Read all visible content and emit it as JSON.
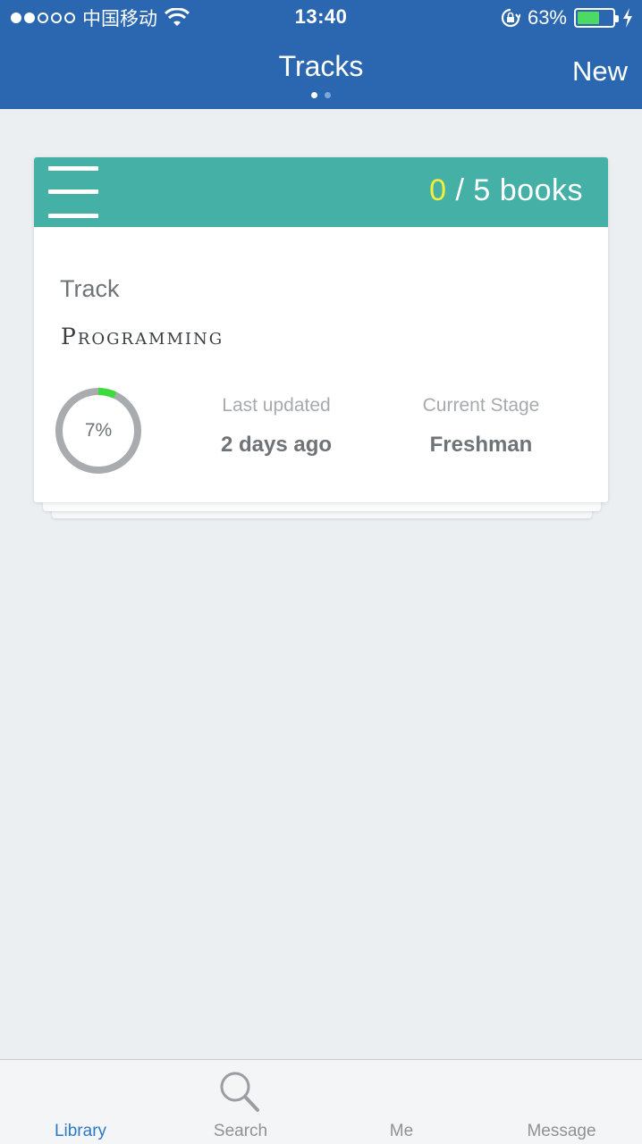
{
  "status_bar": {
    "carrier": "中国移动",
    "time": "13:40",
    "battery_percent_label": "63%",
    "battery_level": 0.63,
    "signal_bars_filled": 2,
    "signal_bars_total": 5
  },
  "nav": {
    "title": "Tracks",
    "right_button": "New",
    "page_count": 2,
    "active_page": 1
  },
  "card": {
    "books_done": "0",
    "books_rest": " / 5 books",
    "track_label": "Track",
    "track_name": "Programming",
    "progress_label": "7%",
    "progress_fraction": 0.07,
    "last_updated_label": "Last updated",
    "last_updated_value": "2 days ago",
    "stage_label": "Current Stage",
    "stage_value": "Freshman"
  },
  "tabs": [
    {
      "label": "Library",
      "icon": "library-icon",
      "active": true
    },
    {
      "label": "Search",
      "icon": "search-icon",
      "active": false
    },
    {
      "label": "Me",
      "icon": "me-icon",
      "active": false
    },
    {
      "label": "Message",
      "icon": "message-icon",
      "active": false
    }
  ],
  "colors": {
    "header": "#2b67b0",
    "card_header": "#45b0a6",
    "books_done": "#f4ee3a",
    "progress": "#3ddc3d",
    "ring_track": "#a9acaf",
    "tab_active": "#2b78c8"
  }
}
